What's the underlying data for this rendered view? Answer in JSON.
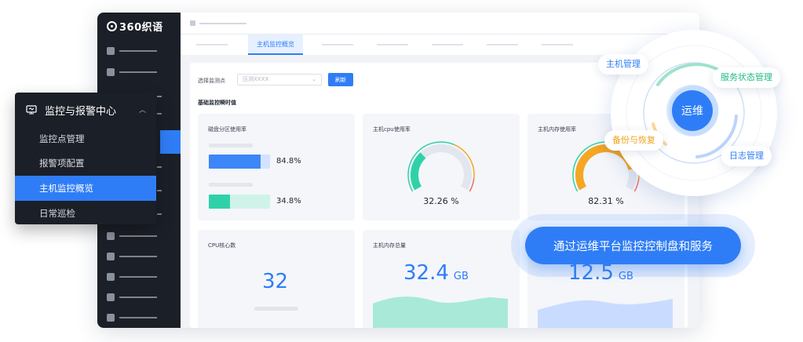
{
  "app": {
    "logo_text": "360织语"
  },
  "tabs": {
    "active_label": "主机监控概览"
  },
  "filter": {
    "label": "选择监测点",
    "placeholder": "压测XXXX",
    "refresh_label": "刷新"
  },
  "section_title": "基础监控瞬时值",
  "cards": {
    "disk": {
      "title": "磁盘分区使用率",
      "bars": [
        {
          "value_text": "84.8%",
          "fraction": 0.848,
          "color": "#3d86f7",
          "track": "#d2e3ff"
        },
        {
          "value_text": "34.8%",
          "fraction": 0.348,
          "color": "#2fd2a8",
          "track": "#cff3e8"
        }
      ]
    },
    "cpu": {
      "title": "主机cpu使用率",
      "value_text": "32.26 %",
      "fraction": 0.3226,
      "color": "#2fd2a8"
    },
    "mem": {
      "title": "主机内存使用率",
      "value_text": "82.31 %",
      "fraction": 0.8231,
      "color": "#f5a623"
    },
    "cores": {
      "title": "CPU核心数",
      "value": "32"
    },
    "mem_total": {
      "title": "主机内存总量",
      "value": "32.4",
      "unit": "GB"
    },
    "third": {
      "value": "12.5",
      "unit": "GB"
    }
  },
  "menu": {
    "title": "监控与报警中心",
    "items": [
      {
        "label": "监控点管理",
        "active": false
      },
      {
        "label": "报警项配置",
        "active": false
      },
      {
        "label": "主机监控概览",
        "active": true
      },
      {
        "label": "日常巡检",
        "active": false
      }
    ]
  },
  "ops": {
    "center": "运维",
    "labels": {
      "host": {
        "text": "主机管理",
        "color": "#2f7df6"
      },
      "service": {
        "text": "服务状态管理",
        "color": "#20b987"
      },
      "backup": {
        "text": "备份与恢复",
        "color": "#f0a21a"
      },
      "log": {
        "text": "日志管理",
        "color": "#2f7df6"
      }
    }
  },
  "cta": {
    "text": "通过运维平台监控控制盘和服务"
  }
}
